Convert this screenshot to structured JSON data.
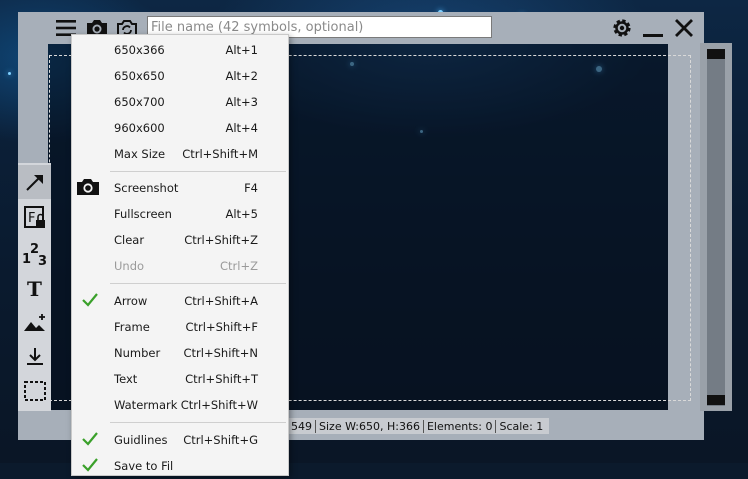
{
  "filename": {
    "placeholder": "File name (42 symbols, optional)",
    "value": ""
  },
  "menu": {
    "items": [
      {
        "label": "650x366",
        "shortcut": "Alt+1",
        "checked": false,
        "disabled": false
      },
      {
        "label": "650x650",
        "shortcut": "Alt+2",
        "checked": false,
        "disabled": false
      },
      {
        "label": "650x700",
        "shortcut": "Alt+3",
        "checked": false,
        "disabled": false
      },
      {
        "label": "960x600",
        "shortcut": "Alt+4",
        "checked": false,
        "disabled": false
      },
      {
        "label": "Max Size",
        "shortcut": "Ctrl+Shift+M",
        "checked": false,
        "disabled": false
      },
      {
        "label": "Screenshot",
        "shortcut": "F4",
        "checked": false,
        "disabled": false,
        "icon": "camera-icon"
      },
      {
        "label": "Fullscreen",
        "shortcut": "Alt+5",
        "checked": false,
        "disabled": false
      },
      {
        "label": "Clear",
        "shortcut": "Ctrl+Shift+Z",
        "checked": false,
        "disabled": false
      },
      {
        "label": "Undo",
        "shortcut": "Ctrl+Z",
        "checked": false,
        "disabled": true
      },
      {
        "label": "Arrow",
        "shortcut": "Ctrl+Shift+A",
        "checked": true,
        "disabled": false
      },
      {
        "label": "Frame",
        "shortcut": "Ctrl+Shift+F",
        "checked": false,
        "disabled": false
      },
      {
        "label": "Number",
        "shortcut": "Ctrl+Shift+N",
        "checked": false,
        "disabled": false
      },
      {
        "label": "Text",
        "shortcut": "Ctrl+Shift+T",
        "checked": false,
        "disabled": false
      },
      {
        "label": "Watermark",
        "shortcut": "Ctrl+Shift+W",
        "checked": false,
        "disabled": false
      },
      {
        "label": "Guidlines",
        "shortcut": "Ctrl+Shift+G",
        "checked": true,
        "disabled": false
      },
      {
        "label": "Save to Fil",
        "shortcut": "",
        "checked": true,
        "disabled": false
      }
    ]
  },
  "status": {
    "position": "549",
    "size": "Size W:650, H:366",
    "elements": "Elements: 0",
    "scale": "Scale: 1"
  },
  "toolbar_icons": [
    "hamburger-menu-icon",
    "camera-icon",
    "refresh-camera-icon",
    "gear-icon",
    "minimize-icon",
    "close-icon"
  ],
  "tools": [
    "arrow-tool-icon",
    "frame-tool-icon",
    "number-tool-icon",
    "text-tool-icon",
    "watermark-tool-icon",
    "save-tool-icon",
    "select-region-icon"
  ],
  "colors": {
    "check": "#3aa02a",
    "frame": "#a7afb9",
    "menu_bg": "#f4f4f4"
  }
}
